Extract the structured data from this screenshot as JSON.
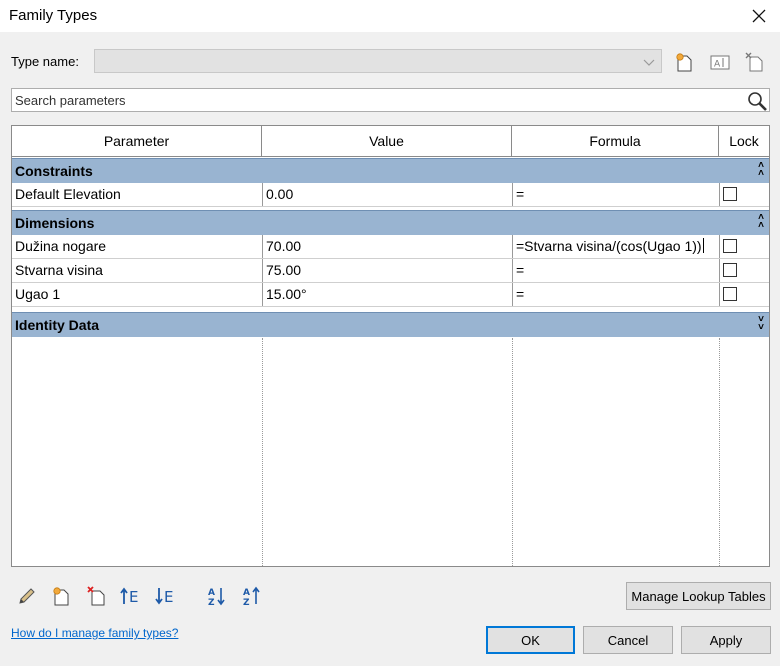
{
  "window": {
    "title": "Family Types"
  },
  "type_name": {
    "label": "Type name:",
    "value": ""
  },
  "search": {
    "placeholder": "Search parameters"
  },
  "grid": {
    "columns": [
      "Parameter",
      "Value",
      "Formula",
      "Lock"
    ],
    "groups": [
      {
        "name": "Constraints",
        "expanded": true,
        "rows": [
          {
            "parameter": "Default Elevation",
            "value": "0.00",
            "formula": "=",
            "locked": false
          }
        ]
      },
      {
        "name": "Dimensions",
        "expanded": true,
        "rows": [
          {
            "parameter": "Dužina nogare",
            "value": "70.00",
            "formula": "=Stvarna visina/(cos(Ugao 1))",
            "locked": false
          },
          {
            "parameter": "Stvarna visina",
            "value": "75.00",
            "formula": "=",
            "locked": false
          },
          {
            "parameter": "Ugao 1",
            "value": "15.00°",
            "formula": "=",
            "locked": false
          }
        ]
      },
      {
        "name": "Identity Data",
        "expanded": false,
        "rows": []
      }
    ]
  },
  "toolbar_icons": [
    "pencil-icon",
    "new-parameter-icon",
    "delete-parameter-icon",
    "move-up-icon",
    "move-down-icon",
    "sort-ascending-icon",
    "sort-descending-icon"
  ],
  "buttons": {
    "manage_lookup": "Manage Lookup Tables",
    "ok": "OK",
    "cancel": "Cancel",
    "apply": "Apply"
  },
  "help_link": "How do I manage family types?",
  "colors": {
    "group_header": "#99b4d1",
    "accent": "#0078d7",
    "link": "#0066cc"
  }
}
